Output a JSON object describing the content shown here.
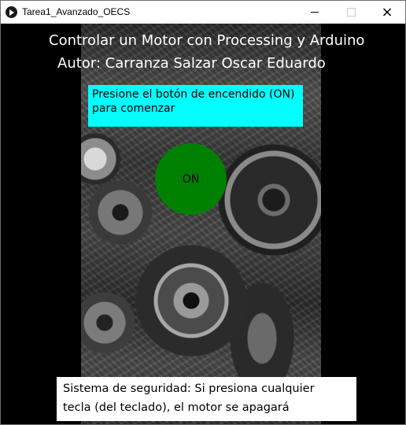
{
  "window": {
    "title": "Tarea1_Avanzado_OECS",
    "controls": {
      "minimize": "minimize",
      "maximize": "maximize",
      "close": "×"
    }
  },
  "header": {
    "title": "Controlar un Motor con Processing y Arduino",
    "author": "Autor: Carranza Salzar Oscar Eduardo"
  },
  "instruction": {
    "line1": "Presione el botón de encendido (ON)",
    "line2": "para comenzar"
  },
  "power_button": {
    "label": "ON",
    "color": "#008000"
  },
  "security_notice": {
    "line1": "Sistema de seguridad: Si presiona cualquier",
    "line2": "tecla (del teclado), el motor se apagará"
  },
  "colors": {
    "instruction_bg": "#00ffff",
    "canvas_bg": "#000000",
    "notice_bg": "#ffffff"
  },
  "icons": {
    "app": "processing-play-icon",
    "background": "engine-photo"
  }
}
